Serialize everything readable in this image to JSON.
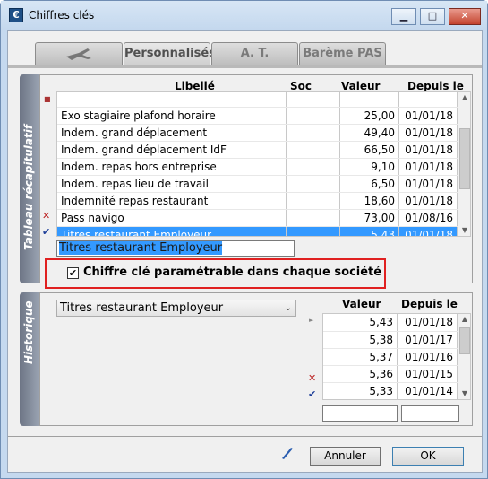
{
  "window": {
    "title": "Chiffres clés",
    "icon": "€"
  },
  "tabs": [
    {
      "label": ""
    },
    {
      "label": "Personnalisés"
    },
    {
      "label": "A. T."
    },
    {
      "label": "Barème PAS"
    }
  ],
  "summary": {
    "side_label": "Tableau récapitulatif",
    "columns": {
      "libelle": "Libellé",
      "soc": "Soc",
      "valeur": "Valeur",
      "depuis": "Depuis le"
    },
    "rows": [
      {
        "libelle": "Exo stagiaire plafond horaire",
        "valeur": "25,00",
        "depuis": "01/01/18"
      },
      {
        "libelle": "Indem. grand déplacement",
        "valeur": "49,40",
        "depuis": "01/01/18"
      },
      {
        "libelle": "Indem. grand déplacement IdF",
        "valeur": "66,50",
        "depuis": "01/01/18"
      },
      {
        "libelle": "Indem. repas hors entreprise",
        "valeur": "9,10",
        "depuis": "01/01/18"
      },
      {
        "libelle": "Indem. repas lieu de travail",
        "valeur": "6,50",
        "depuis": "01/01/18"
      },
      {
        "libelle": "Indemnité repas restaurant",
        "valeur": "18,60",
        "depuis": "01/01/18"
      },
      {
        "libelle": "Pass navigo",
        "valeur": "73,00",
        "depuis": "01/08/16"
      },
      {
        "libelle": "Titres restaurant Employeur",
        "valeur": "5,43",
        "depuis": "01/01/18"
      }
    ],
    "name_value": "Titres restaurant Employeur",
    "checkbox_label": "Chiffre clé paramétrable dans chaque société"
  },
  "history": {
    "side_label": "Historique",
    "select_value": "Titres restaurant Employeur",
    "columns": {
      "valeur": "Valeur",
      "depuis": "Depuis le"
    },
    "rows": [
      {
        "valeur": "5,43",
        "depuis": "01/01/18"
      },
      {
        "valeur": "5,38",
        "depuis": "01/01/17"
      },
      {
        "valeur": "5,37",
        "depuis": "01/01/16"
      },
      {
        "valeur": "5,36",
        "depuis": "01/01/15"
      },
      {
        "valeur": "5,33",
        "depuis": "01/01/14"
      }
    ]
  },
  "buttons": {
    "cancel": "Annuler",
    "ok": "OK"
  }
}
